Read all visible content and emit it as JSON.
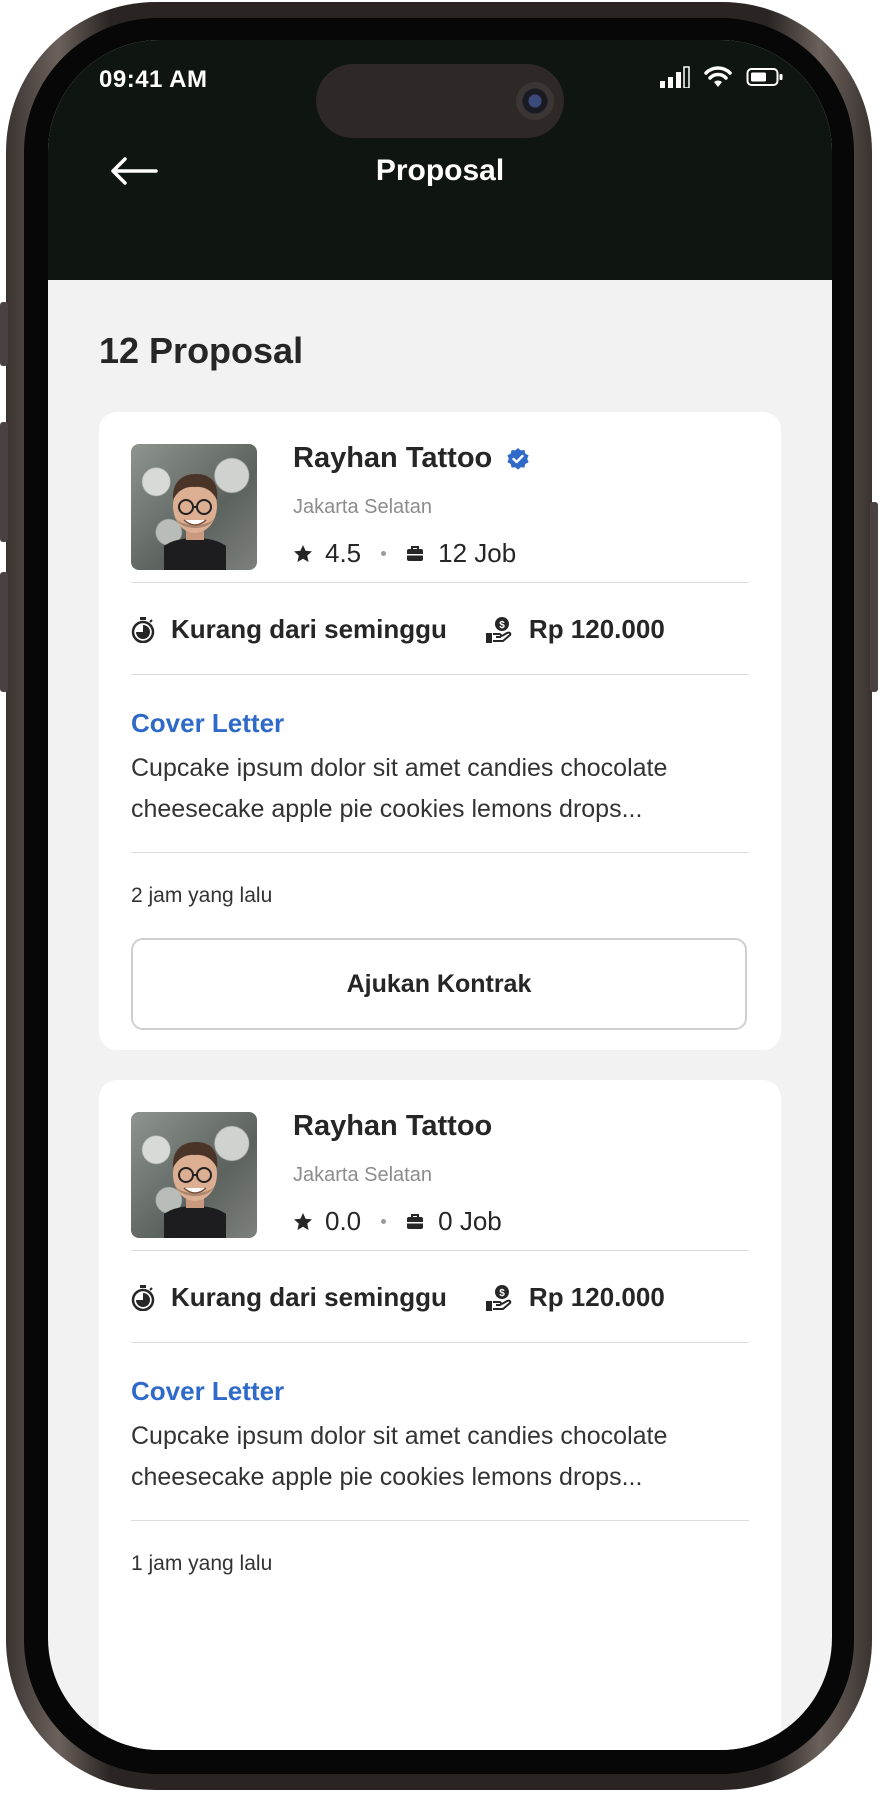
{
  "status_bar": {
    "time": "09:41 AM"
  },
  "header": {
    "title": "Proposal"
  },
  "summary": {
    "count_title": "12 Proposal"
  },
  "proposals": [
    {
      "name": "Rayhan Tattoo",
      "verified": true,
      "location": "Jakarta Selatan",
      "rating": "4.5",
      "jobs": "12 Job",
      "duration": "Kurang dari seminggu",
      "price": "Rp 120.000",
      "cover_letter_label": "Cover Letter",
      "cover_letter": "Cupcake ipsum dolor sit amet candies chocolate cheesecake apple pie cookies lemons drops...",
      "time_ago": "2 jam yang lalu",
      "action_label": "Ajukan Kontrak"
    },
    {
      "name": "Rayhan Tattoo",
      "verified": false,
      "location": "Jakarta Selatan",
      "rating": "0.0",
      "jobs": "0 Job",
      "duration": "Kurang dari seminggu",
      "price": "Rp 120.000",
      "cover_letter_label": "Cover Letter",
      "cover_letter": "Cupcake ipsum dolor sit amet candies chocolate cheesecake apple pie cookies lemons drops...",
      "time_ago": "1 jam yang lalu"
    }
  ],
  "colors": {
    "header_bg": "#0f1510",
    "accent": "#2f6ac8",
    "background": "#f2f2f2"
  },
  "icons": [
    "back-arrow-icon",
    "signal-icon",
    "wifi-icon",
    "battery-icon",
    "verified-badge-icon",
    "star-icon",
    "briefcase-icon",
    "stopwatch-icon",
    "money-hand-icon"
  ]
}
